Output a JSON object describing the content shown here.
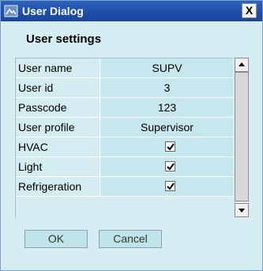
{
  "window": {
    "title": "User Dialog",
    "close_label": "X"
  },
  "settings": {
    "heading": "User settings",
    "rows": [
      {
        "label": "User name",
        "value": "SUPV"
      },
      {
        "label": "User id",
        "value": "3"
      },
      {
        "label": "Passcode",
        "value": "123"
      },
      {
        "label": "User profile",
        "value": "Supervisor"
      },
      {
        "label": "HVAC",
        "checked": true
      },
      {
        "label": "Light",
        "checked": true
      },
      {
        "label": "Refrigeration",
        "checked": true
      }
    ]
  },
  "buttons": {
    "ok": "OK",
    "cancel": "Cancel"
  },
  "colors": {
    "background": "#d6eef3",
    "titlebar": "#1f4fa8",
    "row_bg": "#c7e7ee",
    "button_bg": "#bfe4ea"
  },
  "icons": {
    "app": "user-dialog-icon",
    "close": "close-icon",
    "scroll_up": "scroll-up-icon",
    "scroll_down": "scroll-down-icon",
    "check": "check-icon"
  }
}
